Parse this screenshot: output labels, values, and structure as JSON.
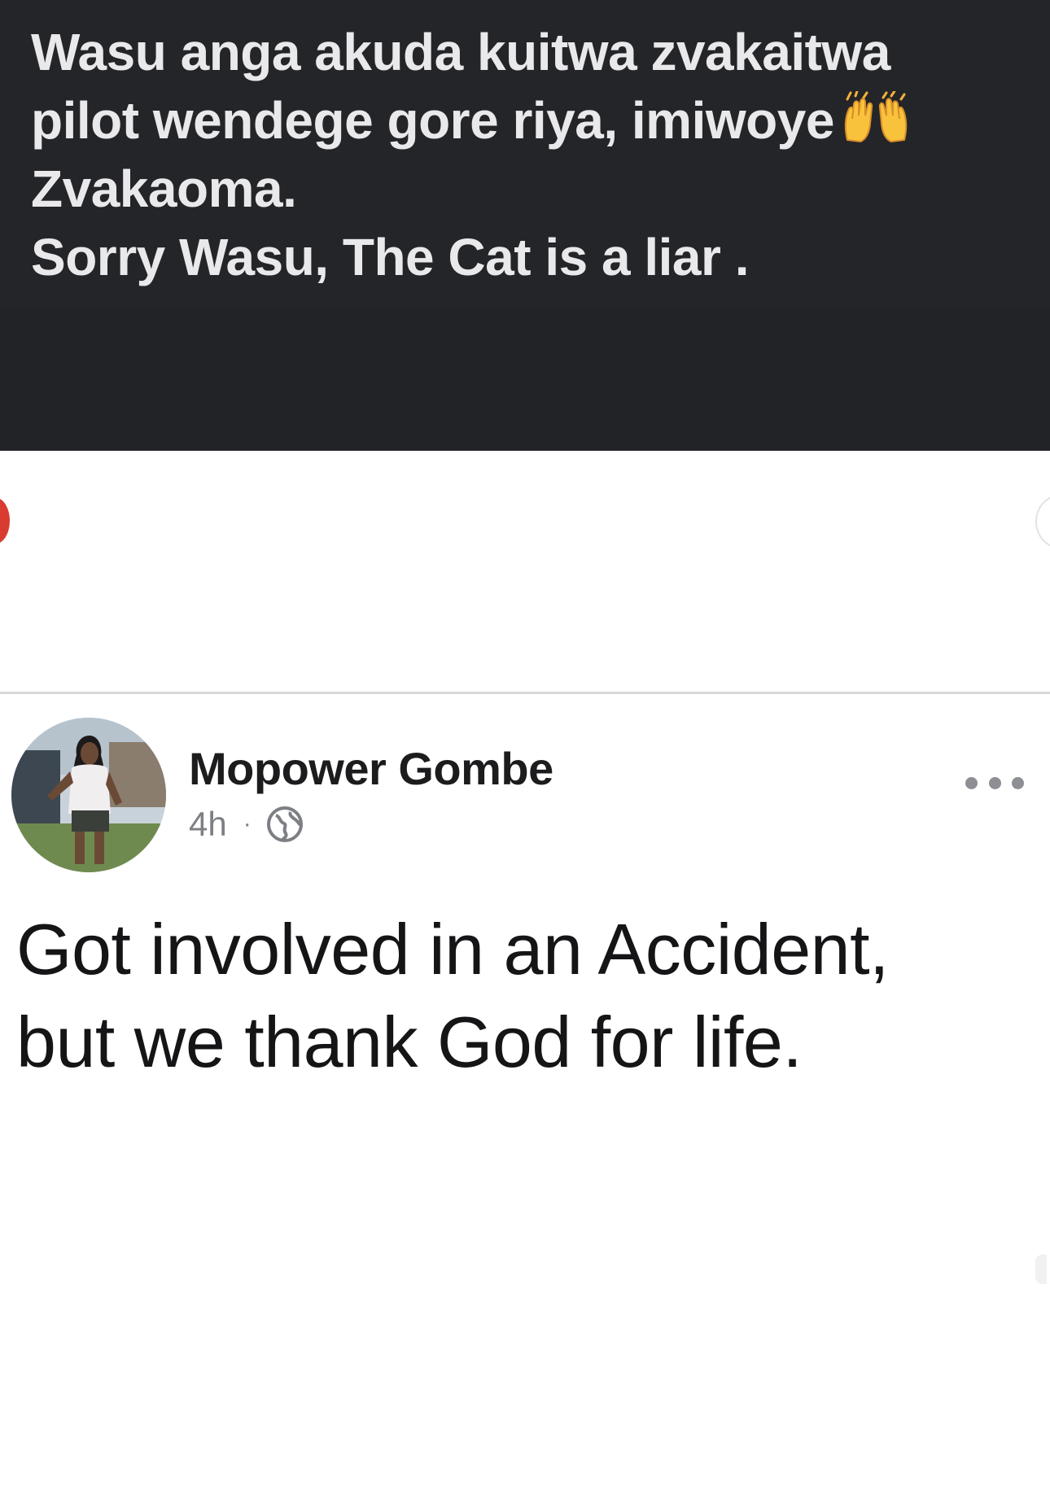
{
  "caption": {
    "line1": "Wasu anga akuda kuitwa zvakaitwa",
    "line2": "pilot wendege gore riya, imiwoye",
    "line2_emoji": "raising-hands-emoji",
    "line3": "Zvakaoma.",
    "line4": "Sorry Wasu, The Cat is a liar ."
  },
  "post": {
    "author": "Mopower Gombe",
    "time": "4h",
    "separator": "·",
    "privacy_icon": "globe-icon",
    "more_icon": "more-dots-icon",
    "text_line1": "Got involved in an Accident,",
    "text_line2": "but we thank God for life."
  },
  "colors": {
    "dark_background": "#222326",
    "caption_text": "#e9e9ec",
    "post_text": "#151517",
    "meta_text": "#7d7f85",
    "accent_red": "#d93b30"
  }
}
